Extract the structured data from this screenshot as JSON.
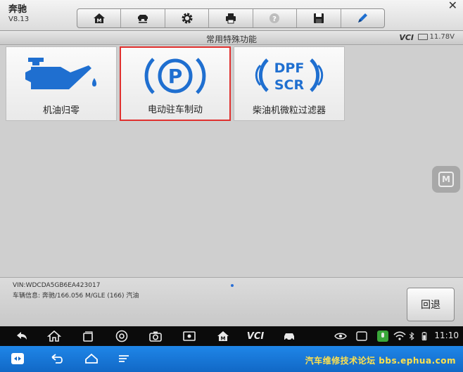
{
  "app": {
    "brand": "奔驰",
    "version": "V8.13"
  },
  "titlebar": {
    "title": "常用特殊功能",
    "vci": "VCI",
    "battery": "11.78V"
  },
  "toolbar": [
    "home-icon",
    "vehicle-swap-icon",
    "settings-gear-icon",
    "printer-icon",
    "help-icon",
    "save-icon",
    "edit-pen-icon"
  ],
  "tiles": [
    {
      "label": "机油归零",
      "icon": "oil-can-icon",
      "selected": false
    },
    {
      "label": "电动驻车制动",
      "icon": "parking-brake-icon",
      "selected": true
    },
    {
      "label": "柴油机微粒过滤器",
      "icon": "dpf-scr-icon",
      "selected": false,
      "icon_text_top": "DPF",
      "icon_text_bottom": "SCR"
    }
  ],
  "side_button": {
    "letter": "M"
  },
  "vehicle": {
    "vin": "VIN:WDCDA5GB6EA423017",
    "info": "车辆信息: 奔驰/166.056 M/GLE (166) 汽油"
  },
  "back_button": {
    "label": "回退"
  },
  "navbar": {
    "vci_label": "VCI",
    "clock": "11:10"
  },
  "watermark": "汽车维修技术论坛 bbs.ephua.com",
  "colors": {
    "accent_blue": "#1f6fd0",
    "selected_border": "#e0302e",
    "remote_bar": "#1876db",
    "watermark": "#ffe14d"
  }
}
